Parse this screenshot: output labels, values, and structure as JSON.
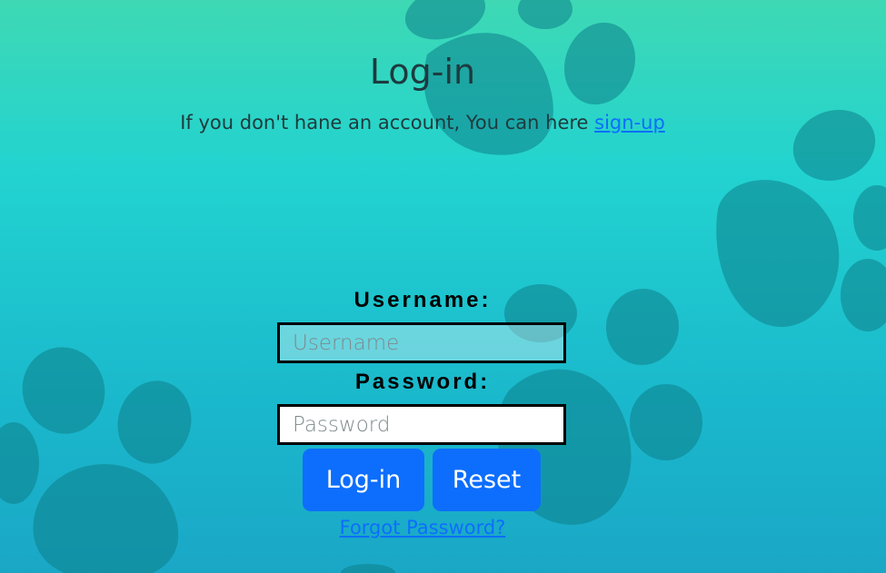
{
  "page": {
    "title": "Log-in",
    "subtitle_text": "If you don't hane an account, You can here ",
    "signup_link": "sign-up"
  },
  "form": {
    "username_label": "Username:",
    "username_placeholder": "Username",
    "username_value": "",
    "password_label": "Password:",
    "password_placeholder": "Password",
    "password_value": "",
    "login_button": "Log-in",
    "reset_button": "Reset",
    "forgot_link": "Forgot Password?"
  },
  "background": {
    "decoration": "paw-prints-pattern",
    "colors": {
      "top": "#3ed9b4",
      "middle": "#22d3d0",
      "bottom": "#1aa7c6",
      "paw": "#0e7f8c"
    }
  },
  "theme": {
    "primary": "#0d6efd",
    "heading_color": "#1d3b3f"
  }
}
